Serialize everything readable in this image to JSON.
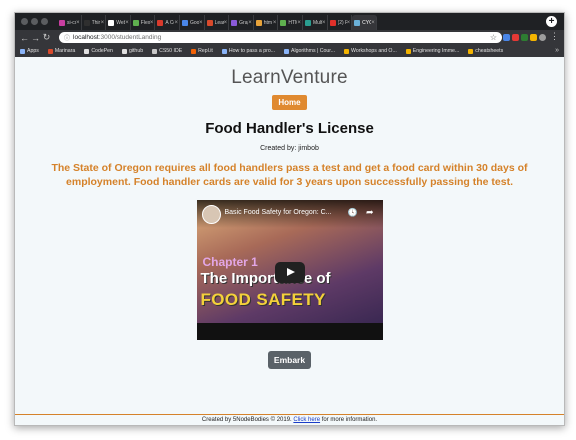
{
  "browser": {
    "tabs": [
      {
        "title": "si-cc",
        "color": "#c83ea0"
      },
      {
        "title": "Thir",
        "color": "#2f2f2f"
      },
      {
        "title": "Web",
        "color": "#ffffff"
      },
      {
        "title": "Flexl",
        "color": "#5fb04f"
      },
      {
        "title": "A Co",
        "color": "#d93a2c"
      },
      {
        "title": "Goo",
        "color": "#4a86e8"
      },
      {
        "title": "Lear",
        "color": "#d94a2c"
      },
      {
        "title": "Grap",
        "color": "#8a5ad8"
      },
      {
        "title": "htm",
        "color": "#e8a33a"
      },
      {
        "title": "HTM",
        "color": "#5fb04f"
      },
      {
        "title": "Mult",
        "color": "#2a9d8f"
      },
      {
        "title": "(2) F",
        "color": "#e0302a"
      },
      {
        "title": "CYO",
        "color": "#6ab0d8",
        "active": true
      }
    ],
    "url_host": "localhost",
    "url_path": ":3000/studentLanding",
    "bookmarks": [
      {
        "label": "Apps",
        "color": "#8ab4f8"
      },
      {
        "label": "Marinara",
        "color": "#d94a2c"
      },
      {
        "label": "CodePen",
        "color": "#e0e0e0"
      },
      {
        "label": "github",
        "color": "#e0e0e0"
      },
      {
        "label": "CS50 IDE",
        "color": "#c8c8c8"
      },
      {
        "label": "Repl.it",
        "color": "#f26207"
      },
      {
        "label": "How to pass a pro...",
        "color": "#8ab4f8"
      },
      {
        "label": "Algorithms | Cour...",
        "color": "#8ab4f8"
      },
      {
        "label": "Workshops and O...",
        "color": "#f4b400"
      },
      {
        "label": "Engineering Imme...",
        "color": "#f4b400"
      },
      {
        "label": "cheatsheets",
        "color": "#f4b400"
      }
    ],
    "more_bookmarks": "»"
  },
  "page": {
    "brand": "LearnVenture",
    "home_label": "Home",
    "title": "Food Handler's License",
    "created_by": "Created by: jimbob",
    "description": "The State of Oregon requires all food handlers pass a test and get a food card within 30 days of employment. Food handler cards are valid for 3 years upon successfully passing the test.",
    "video": {
      "title": "Basic Food Safety for Oregon: C...",
      "chapter": "Chapter 1",
      "line1": "The Importance of",
      "line2": "FOOD SAFETY"
    },
    "embark_label": "Embark",
    "footer": {
      "prefix": "Created by 5NodeBodies © 2019.",
      "link": "Click here",
      "suffix": "for more information."
    }
  },
  "colors": {
    "accent": "#e08a30",
    "description": "#d5822a",
    "embark": "#5a6268"
  }
}
